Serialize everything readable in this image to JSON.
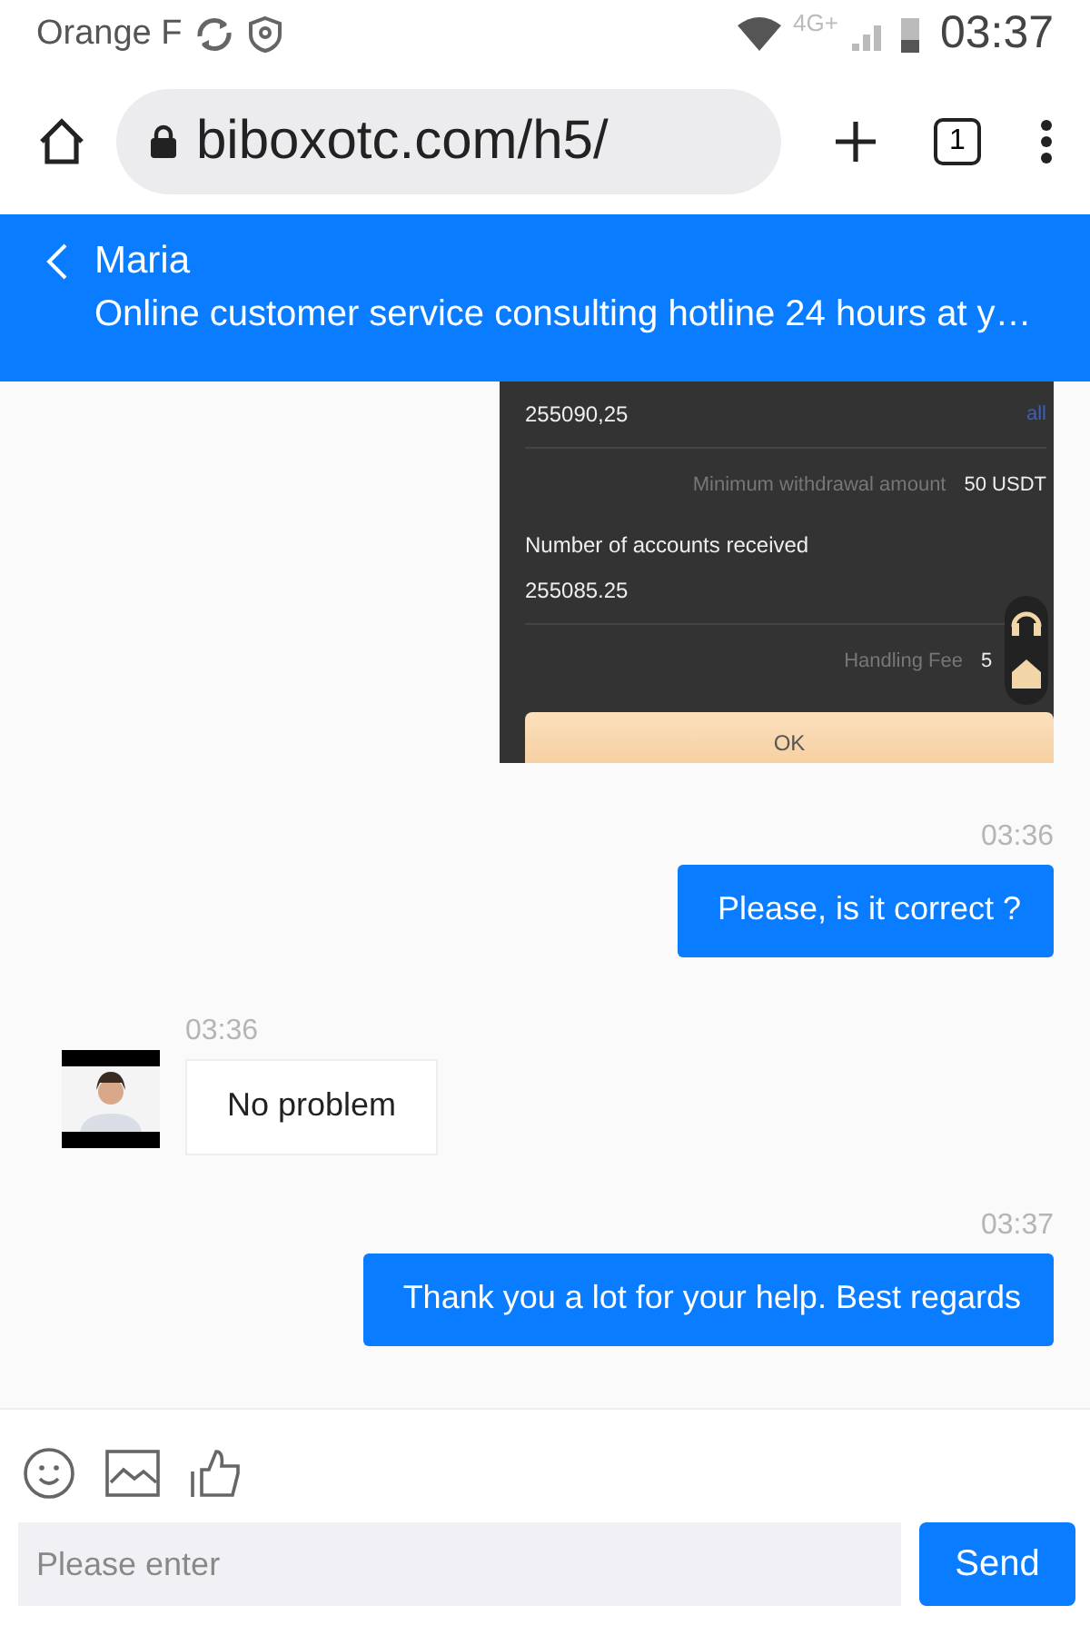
{
  "status_bar": {
    "carrier": "Orange F",
    "network": "4G+",
    "time": "03:37"
  },
  "browser": {
    "url": "biboxotc.com/h5/",
    "tab_count": "1"
  },
  "header": {
    "title": "Maria",
    "subtitle": "Online customer service consulting hotline 24 hours at y…"
  },
  "messages": [
    {
      "kind": "screenshot",
      "outgoing": true,
      "amount": "255090,25",
      "all_link": "all",
      "min_label": "Minimum withdrawal amount",
      "min_value": "50 USDT",
      "received_label": "Number of accounts received",
      "received_value": "255085.25",
      "fee_label": "Handling Fee",
      "fee_value": "5",
      "ok": "OK"
    },
    {
      "kind": "text",
      "outgoing": true,
      "time": "03:36",
      "text": "Please, is it correct ?"
    },
    {
      "kind": "text",
      "outgoing": false,
      "time": "03:36",
      "text": "No problem"
    },
    {
      "kind": "text",
      "outgoing": true,
      "time": "03:37",
      "text": "Thank you a lot for your help. Best regards"
    }
  ],
  "composer": {
    "placeholder": "Please enter",
    "send": "Send"
  }
}
